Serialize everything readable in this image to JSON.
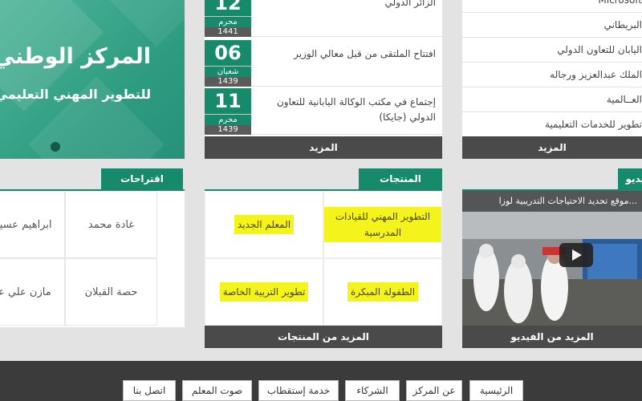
{
  "banner": {
    "title": "المركز الوطني",
    "subtitle": "للتطوير المهني التعليمي"
  },
  "news": {
    "items": [
      {
        "day": "12",
        "month": "محرم",
        "year": "1441",
        "text": "الزائر الدولي"
      },
      {
        "day": "06",
        "month": "شعبان",
        "year": "1439",
        "text": "افتتاح الملتقى من قبل معالي الوزير"
      },
      {
        "day": "11",
        "month": "محرم",
        "year": "1439",
        "text": "إجتماع في مكتب الوكالة اليابانية للتعاون الدولي (جايكا)"
      }
    ],
    "more_label": "المزيد"
  },
  "partners": {
    "items": [
      "Microsoft",
      "البريطاني",
      "اليابان للتعاون الدولي",
      "الملك عبدالعزيز ورجاله",
      "العــالمية",
      "تطوير للخدمات التعليمية"
    ],
    "more_label": "المزيد"
  },
  "teachers": {
    "heading": "اقتراحات المعلمين",
    "names": [
      "غادة محمد",
      "ابراهيم عسيري",
      "حصة القبلان",
      "مازن علي عبيد"
    ]
  },
  "products": {
    "heading": "المنتجات",
    "items": [
      "التطوير المهني للقيادات المدرسية",
      "المعلم الجديد",
      "الطفولة المبكرة",
      "تطوير التربية الخاصة"
    ],
    "more_label": "المزيد من المنتجات",
    "highlight_color": "#f5f31c"
  },
  "video": {
    "heading": "الفيديو",
    "title": "...موقع تحديد الاحتياجات التدريبية لوزا",
    "more_label": "المزيد من الفيديو"
  },
  "nav": {
    "items": [
      "الرئيسية",
      "عن المركز",
      "الشركاء",
      "خدمة إستقطاب",
      "صوت المعلم",
      "اتصل بنا"
    ]
  },
  "colors": {
    "accent": "#188a6c",
    "dark_bar": "#4a4a4a",
    "footer": "#3b3b3b"
  }
}
